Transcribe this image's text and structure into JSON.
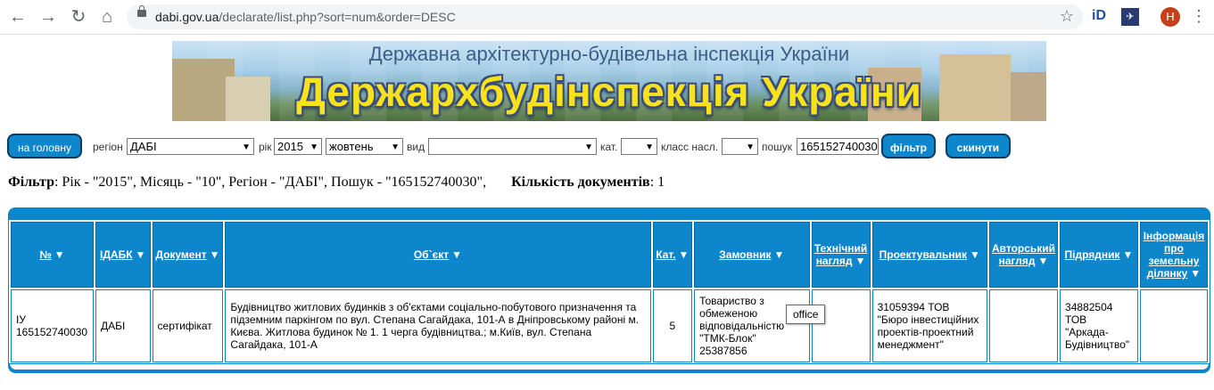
{
  "browser": {
    "url_domain": "dabi.gov.ua",
    "url_path": "/declarate/list.php?sort=num&order=DESC",
    "ext1": "iD",
    "avatar_letter": "Н"
  },
  "banner": {
    "subtitle": "Державна архітектурно-будівельна інспекція України",
    "title": "Держархбудінспекція України"
  },
  "filters": {
    "home_label": "на головну",
    "region_label": "регіон",
    "region_value": "ДАБІ",
    "year_label": "рік",
    "year_value": "2015",
    "month_value": "жовтень",
    "type_label": "вид",
    "type_value": "",
    "cat_label": "кат.",
    "cat_value": "",
    "class_label": "класс насл.",
    "class_value": "",
    "search_label": "пошук",
    "search_value": "165152740030",
    "filter_button": "фільтр",
    "reset_button": "скинути"
  },
  "info": {
    "filter_label": "Фільтр",
    "filter_text": ": Рік - \"2015\", Місяць - \"10\", Регіон - \"ДАБІ\", Пошук - \"165152740030\",",
    "count_label": "Кількість документів",
    "count_value": ": 1"
  },
  "table": {
    "headers": {
      "num": "№",
      "idabk": "ІДАБК",
      "doc": "Документ",
      "object": "Об`єкт",
      "cat": "Кат.",
      "customer": "Замовник",
      "tech1": "Технічний",
      "tech2": "нагляд",
      "designer": "Проектувальник",
      "author1": "Авторський",
      "author2": "нагляд",
      "contractor": "Підрядник",
      "land1": "Інформація",
      "land2": "про",
      "land3": "земельну",
      "land4": "ділянку"
    },
    "row": {
      "num1": "ІУ",
      "num2": "165152740030",
      "idabk": "ДАБІ",
      "doc": "сертифікат",
      "object": "Будівництво житлових будинків з об'єктами соціально-побутового призначення та підземним паркінгом по вул. Степана Сагайдака, 101-А в Дніпровському районі м. Києва. Житлова будинок № 1. 1 черга будівництва.; м.Київ, вул. Степана Сагайдака, 101-А",
      "cat": "5",
      "customer1": "Товариство з",
      "customer2": "обмеженою",
      "customer3": "відповідальністю",
      "customer4": "\"ТМК-Блок\"",
      "customer5": "25387856",
      "tech": "",
      "designer1": "31059394 ТОВ",
      "designer2": "\"Бюро інвестиційних",
      "designer3": "проектів-проектний",
      "designer4": "менеджмент\"",
      "author": "",
      "contractor1": "34882504",
      "contractor2": "ТОВ",
      "contractor3": "\"Аркада-",
      "contractor4": "Будівництво\"",
      "land": ""
    }
  },
  "tooltip": "office"
}
